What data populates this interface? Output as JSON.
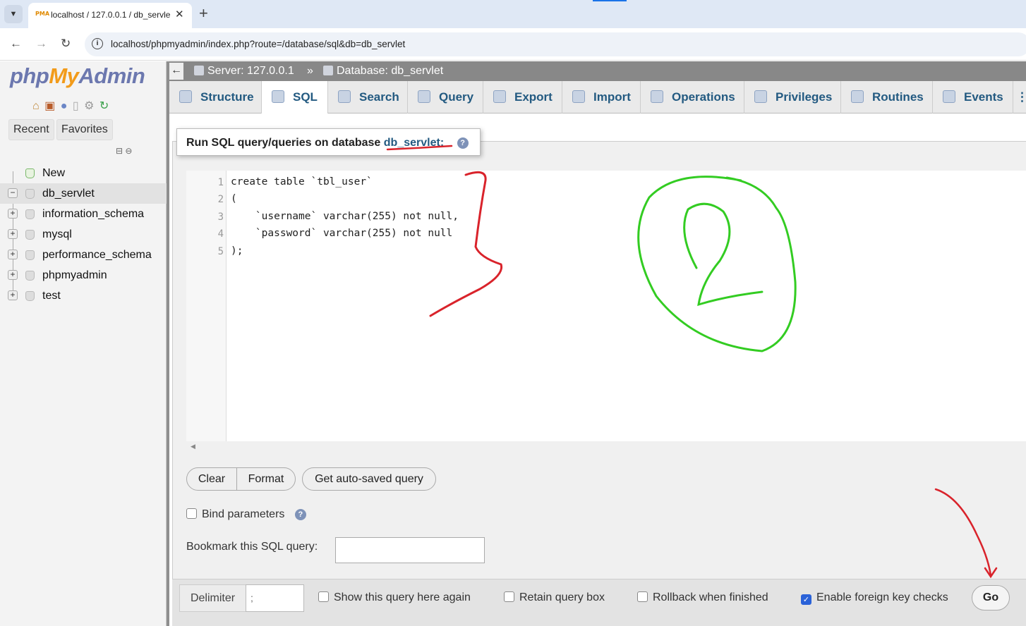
{
  "browser": {
    "tab_title": "localhost / 127.0.0.1 / db_servle",
    "tab_favicon": "PMA",
    "url": "localhost/phpmyadmin/index.php?route=/database/sql&db=db_servlet"
  },
  "sidebar": {
    "logo_php": "php",
    "logo_my": "My",
    "logo_admin": "Admin",
    "recent": "Recent",
    "favorites": "Favorites",
    "tree": [
      {
        "label": "New",
        "type": "new"
      },
      {
        "label": "db_servlet",
        "expanded": true,
        "selected": true
      },
      {
        "label": "information_schema"
      },
      {
        "label": "mysql"
      },
      {
        "label": "performance_schema"
      },
      {
        "label": "phpmyadmin"
      },
      {
        "label": "test"
      }
    ]
  },
  "breadcrumb": {
    "server": "Server: 127.0.0.1",
    "separator": "»",
    "database": "Database: db_servlet"
  },
  "tabs": [
    {
      "label": "Structure",
      "icon": "structure-icon"
    },
    {
      "label": "SQL",
      "icon": "sql-icon",
      "active": true
    },
    {
      "label": "Search",
      "icon": "search-icon"
    },
    {
      "label": "Query",
      "icon": "query-icon"
    },
    {
      "label": "Export",
      "icon": "export-icon"
    },
    {
      "label": "Import",
      "icon": "import-icon"
    },
    {
      "label": "Operations",
      "icon": "wrench-icon"
    },
    {
      "label": "Privileges",
      "icon": "privileges-icon"
    },
    {
      "label": "Routines",
      "icon": "routines-icon"
    },
    {
      "label": "Events",
      "icon": "clock-icon"
    }
  ],
  "sql_panel": {
    "legend_prefix": "Run SQL query/queries on database",
    "legend_db": "db_servlet:",
    "help": "?",
    "lines": [
      "1",
      "2",
      "3",
      "4",
      "5"
    ],
    "code": [
      "create table `tbl_user`",
      "(",
      "    `username` varchar(255) not null,",
      "    `password` varchar(255) not null",
      ");"
    ],
    "clear": "Clear",
    "format": "Format",
    "autosaved": "Get auto-saved query",
    "bind_params": "Bind parameters",
    "bookmark_label": "Bookmark this SQL query:",
    "bookmark_value": ""
  },
  "footer": {
    "delimiter": "Delimiter",
    "delimiter_value": ";",
    "show_query": "Show this query here again",
    "retain": "Retain query box",
    "rollback": "Rollback when finished",
    "fk_checks": "Enable foreign key checks",
    "fk_checked": true,
    "go": "Go"
  },
  "annotation": {
    "circled_number": "2",
    "colors": {
      "red": "#d9232b",
      "green": "#33cc22"
    }
  }
}
